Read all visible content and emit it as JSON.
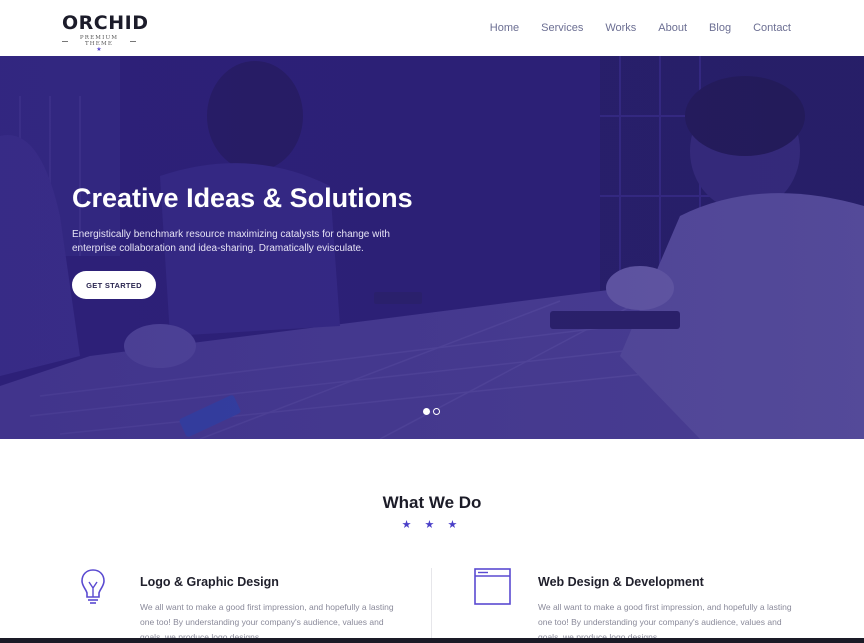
{
  "logo": {
    "title": "ORCHID",
    "subtitle": "PREMIUM THEME",
    "mark": "★"
  },
  "nav": {
    "items": [
      "Home",
      "Services",
      "Works",
      "About",
      "Blog",
      "Contact"
    ]
  },
  "hero": {
    "title": "Creative Ideas & Solutions",
    "text": "Energistically benchmark resource maximizing catalysts for change with enterprise collaboration and idea-sharing. Dramatically evisculate.",
    "button": "GET STARTED",
    "slides_total": 2,
    "active_slide": 1
  },
  "what_we_do": {
    "title": "What We Do",
    "stars": "★ ★ ★",
    "services": [
      {
        "title": "Logo & Graphic Design",
        "text": "We all want to make a good first impression, and hopefully a lasting one too! By understanding your company's audience, values and goals, we produce logo designs",
        "icon": "lightbulb-icon"
      },
      {
        "title": "Web Design & Development",
        "text": "We all want to make a good first impression, and hopefully a lasting one too! By understanding your company's audience, values and goals, we produce logo designs",
        "icon": "browser-window-icon"
      }
    ]
  },
  "colors": {
    "brand": "#4a3fc8",
    "hero_bg": "#2c2177",
    "nav_text": "#6c6f93"
  }
}
